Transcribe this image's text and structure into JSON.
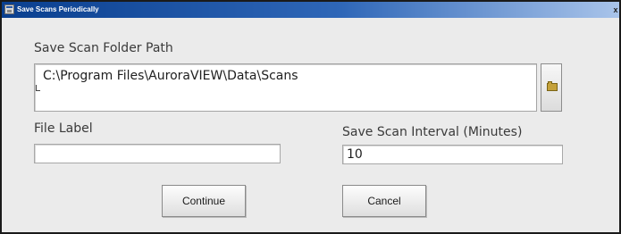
{
  "window": {
    "title": "Save Scans Periodically",
    "close_glyph": "x"
  },
  "folder": {
    "label": "Save Scan Folder Path",
    "value": "C:\\Program Files\\AuroraVIEW\\Data\\Scans",
    "browse_icon": "folder-icon"
  },
  "file_label": {
    "label": "File Label",
    "value": ""
  },
  "interval": {
    "label": "Save Scan Interval (Minutes)",
    "value": "10"
  },
  "buttons": {
    "continue_label": "Continue",
    "cancel_label": "Cancel"
  },
  "colors": {
    "titlebar_start": "#0a3f8f",
    "titlebar_end": "#a9c4ea",
    "window_background": "#ebebeb"
  }
}
